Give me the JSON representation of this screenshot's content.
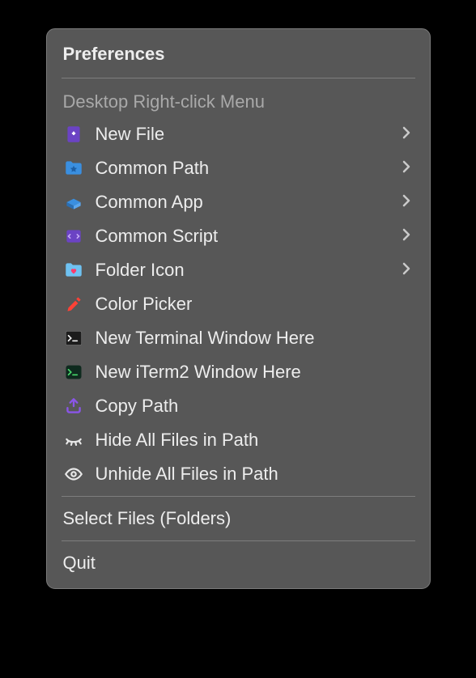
{
  "menu": {
    "preferences_label": "Preferences",
    "section_title": "Desktop Right-click Menu",
    "items": [
      {
        "label": "New File",
        "has_submenu": true
      },
      {
        "label": "Common Path",
        "has_submenu": true
      },
      {
        "label": "Common App",
        "has_submenu": true
      },
      {
        "label": "Common Script",
        "has_submenu": true
      },
      {
        "label": "Folder Icon",
        "has_submenu": true
      },
      {
        "label": "Color Picker",
        "has_submenu": false
      },
      {
        "label": "New Terminal Window Here",
        "has_submenu": false
      },
      {
        "label": "New iTerm2 Window Here",
        "has_submenu": false
      },
      {
        "label": "Copy Path",
        "has_submenu": false
      },
      {
        "label": "Hide All Files in Path",
        "has_submenu": false
      },
      {
        "label": "Unhide All Files in Path",
        "has_submenu": false
      }
    ],
    "select_files_label": "Select Files (Folders)",
    "quit_label": "Quit"
  }
}
